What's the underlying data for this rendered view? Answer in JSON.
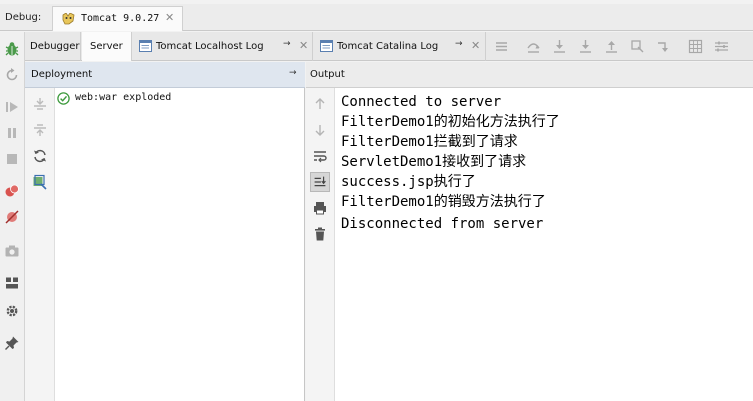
{
  "debug": {
    "label": "Debug:",
    "tab": {
      "title": "Tomcat 9.0.27",
      "close": "✕"
    }
  },
  "sub_tabs": [
    {
      "label": "Debugger",
      "active": false
    },
    {
      "label": "Server",
      "active": true
    },
    {
      "label": "Tomcat Localhost Log",
      "active": false
    },
    {
      "label": "Tomcat Catalina Log",
      "active": false
    }
  ],
  "deployment": {
    "header": "Deployment",
    "items": [
      {
        "label": "web:war exploded",
        "status": "deployed"
      }
    ]
  },
  "output": {
    "header": "Output",
    "lines": [
      "Connected to server",
      "FilterDemo1的初始化方法执行了",
      "FilterDemo1拦截到了请求",
      "ServletDemo1接收到了请求",
      "success.jsp执行了",
      "FilterDemo1的销毁方法执行了",
      "Disconnected from server"
    ]
  },
  "glyphs": {
    "pin": "→",
    "close": "✕"
  },
  "colors": {
    "accent_green": "#3d9a3d",
    "bug_green": "#4a9a4a",
    "stop_red": "#d9534f",
    "deploy_header_bg": "#dfe6ef"
  }
}
